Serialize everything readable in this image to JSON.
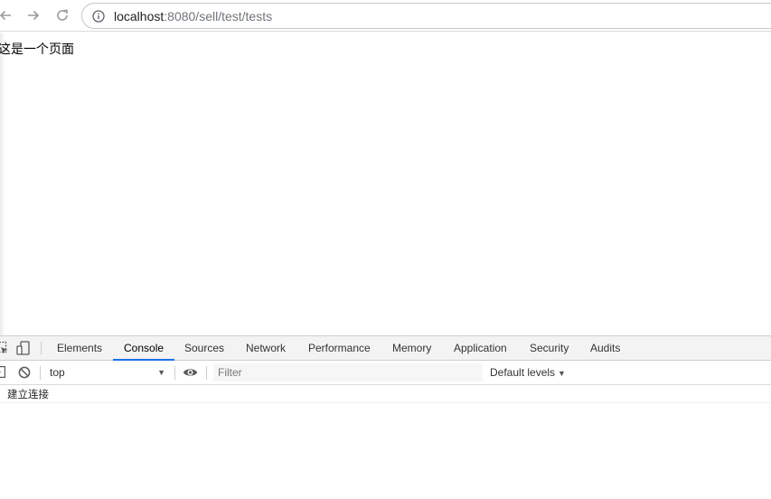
{
  "browser": {
    "url_host": "localhost",
    "url_path": ":8080/sell/test/tests",
    "icons": {
      "back": "back-arrow-icon",
      "forward": "forward-arrow-icon",
      "reload": "reload-icon",
      "site_info": "info-icon"
    }
  },
  "page": {
    "body_text": "这是一个页面"
  },
  "devtools": {
    "tabs": [
      {
        "label": "Elements"
      },
      {
        "label": "Console"
      },
      {
        "label": "Sources"
      },
      {
        "label": "Network"
      },
      {
        "label": "Performance"
      },
      {
        "label": "Memory"
      },
      {
        "label": "Application"
      },
      {
        "label": "Security"
      },
      {
        "label": "Audits"
      }
    ],
    "active_tab": "Console",
    "accent_color": "#1a73e8",
    "console": {
      "context": "top",
      "filter_placeholder": "Filter",
      "levels_label": "Default levels",
      "messages": [
        {
          "text": "建立连接"
        }
      ]
    }
  }
}
